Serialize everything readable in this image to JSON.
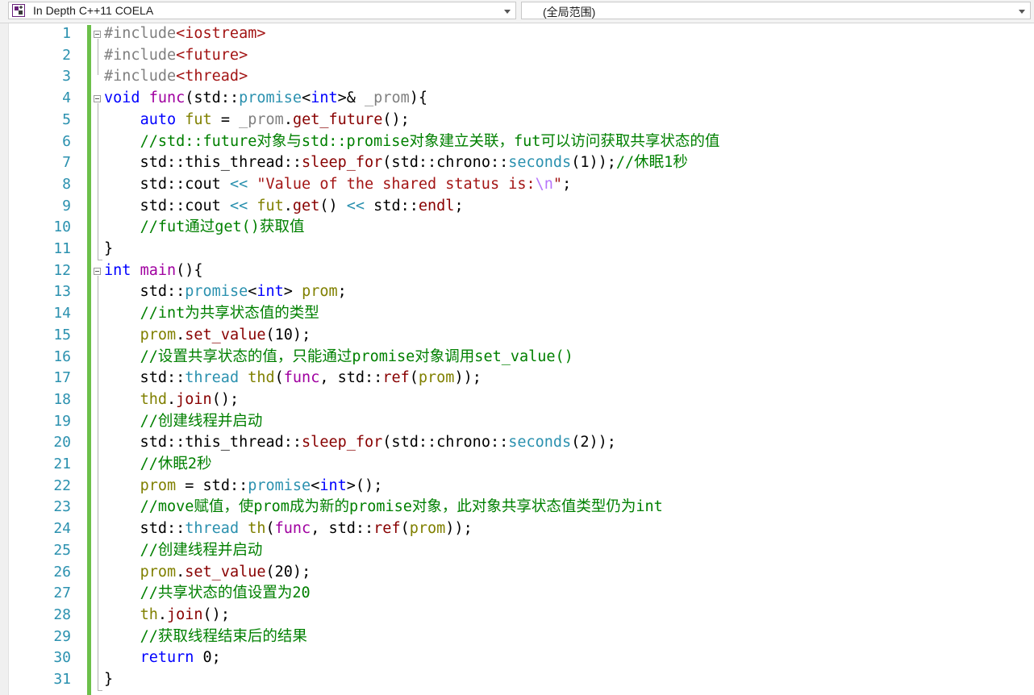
{
  "toolbar": {
    "project_label": "In Depth C++11 COELA",
    "scope_label": "(全局范围)",
    "project_icon": "cpp-project-icon",
    "dropdown_icon": "chevron-down-icon"
  },
  "editor": {
    "colors": {
      "keyword": "#0000ff",
      "type": "#2b91af",
      "comment": "#008000",
      "string": "#a31515",
      "function": "#880000",
      "line_number": "#2b91af",
      "change_bar": "#6cc04a"
    },
    "lines": [
      {
        "n": "1",
        "tokens": [
          [
            "pp",
            "#include"
          ],
          [
            "inc",
            "<iostream>"
          ]
        ]
      },
      {
        "n": "2",
        "tokens": [
          [
            "pp",
            "#include"
          ],
          [
            "inc",
            "<future>"
          ]
        ]
      },
      {
        "n": "3",
        "tokens": [
          [
            "pp",
            "#include"
          ],
          [
            "inc",
            "<thread>"
          ]
        ]
      },
      {
        "n": "4",
        "tokens": [
          [
            "kw",
            "void"
          ],
          [
            "",
            "",
            ""
          ],
          [
            "",
            ""
          ],
          [
            "",
            " "
          ],
          [
            "mfn",
            "func"
          ],
          [
            "",
            "(std::"
          ],
          [
            "ty",
            "promise"
          ],
          [
            "",
            "<"
          ],
          [
            "kw",
            "int"
          ],
          [
            "",
            ">& "
          ],
          [
            "pm",
            "_prom"
          ],
          [
            "",
            "){"
          ]
        ]
      },
      {
        "n": "5",
        "tokens": [
          [
            "",
            "    "
          ],
          [
            "kw",
            "auto"
          ],
          [
            "",
            " "
          ],
          [
            "var",
            "fut"
          ],
          [
            "",
            " = "
          ],
          [
            "pm",
            "_prom"
          ],
          [
            "",
            "."
          ],
          [
            "fn",
            "get_future"
          ],
          [
            "",
            "();"
          ]
        ]
      },
      {
        "n": "6",
        "tokens": [
          [
            "",
            "    "
          ],
          [
            "cm",
            "//std::future对象与std::promise对象建立关联，fut可以访问获取共享状态的值"
          ]
        ]
      },
      {
        "n": "7",
        "tokens": [
          [
            "",
            "    std::this_thread::"
          ],
          [
            "fn",
            "sleep_for"
          ],
          [
            "",
            "(std::chrono::"
          ],
          [
            "ty",
            "seconds"
          ],
          [
            "",
            "(1));"
          ],
          [
            "cm",
            "//休眠1秒"
          ]
        ]
      },
      {
        "n": "8",
        "tokens": [
          [
            "",
            "    std::cout "
          ],
          [
            "ty",
            "<<"
          ],
          [
            "",
            " "
          ],
          [
            "str",
            "\"Value of the shared status is:"
          ],
          [
            "esc",
            "\\n"
          ],
          [
            "str",
            "\""
          ],
          [
            "",
            ";"
          ]
        ]
      },
      {
        "n": "9",
        "tokens": [
          [
            "",
            "    std::cout "
          ],
          [
            "ty",
            "<<"
          ],
          [
            "",
            " "
          ],
          [
            "var",
            "fut"
          ],
          [
            "",
            "."
          ],
          [
            "fn",
            "get"
          ],
          [
            "",
            "() "
          ],
          [
            "ty",
            "<<"
          ],
          [
            "",
            " std::"
          ],
          [
            "fn",
            "endl"
          ],
          [
            "",
            ";"
          ]
        ]
      },
      {
        "n": "10",
        "tokens": [
          [
            "",
            "    "
          ],
          [
            "cm",
            "//fut通过get()获取值"
          ]
        ]
      },
      {
        "n": "11",
        "tokens": [
          [
            "",
            "}"
          ]
        ]
      },
      {
        "n": "12",
        "tokens": [
          [
            "kw",
            "int"
          ],
          [
            "",
            " "
          ],
          [
            "mfn",
            "main"
          ],
          [
            "",
            "(){"
          ]
        ]
      },
      {
        "n": "13",
        "tokens": [
          [
            "",
            "    std::"
          ],
          [
            "ty",
            "promise"
          ],
          [
            "",
            "<"
          ],
          [
            "kw",
            "int"
          ],
          [
            "",
            "> "
          ],
          [
            "var",
            "prom"
          ],
          [
            "",
            ";"
          ]
        ]
      },
      {
        "n": "14",
        "tokens": [
          [
            "",
            "    "
          ],
          [
            "cm",
            "//int为共享状态值的类型"
          ]
        ]
      },
      {
        "n": "15",
        "tokens": [
          [
            "",
            "    "
          ],
          [
            "var",
            "prom"
          ],
          [
            "",
            "."
          ],
          [
            "fn",
            "set_value"
          ],
          [
            "",
            "(10);"
          ]
        ]
      },
      {
        "n": "16",
        "tokens": [
          [
            "",
            "    "
          ],
          [
            "cm",
            "//设置共享状态的值，只能通过promise对象调用set_value()"
          ]
        ]
      },
      {
        "n": "17",
        "tokens": [
          [
            "",
            "    std::"
          ],
          [
            "ty",
            "thread"
          ],
          [
            "",
            " "
          ],
          [
            "var",
            "thd"
          ],
          [
            "",
            "("
          ],
          [
            "mfn",
            "func"
          ],
          [
            "",
            ", std::"
          ],
          [
            "fn",
            "ref"
          ],
          [
            "",
            "("
          ],
          [
            "var",
            "prom"
          ],
          [
            "",
            "));"
          ]
        ]
      },
      {
        "n": "18",
        "tokens": [
          [
            "",
            "    "
          ],
          [
            "var",
            "thd"
          ],
          [
            "",
            "."
          ],
          [
            "fn",
            "join"
          ],
          [
            "",
            "();"
          ]
        ]
      },
      {
        "n": "19",
        "tokens": [
          [
            "",
            "    "
          ],
          [
            "cm",
            "//创建线程并启动"
          ]
        ]
      },
      {
        "n": "20",
        "tokens": [
          [
            "",
            "    std::this_thread::"
          ],
          [
            "fn",
            "sleep_for"
          ],
          [
            "",
            "(std::chrono::"
          ],
          [
            "ty",
            "seconds"
          ],
          [
            "",
            "(2));"
          ]
        ]
      },
      {
        "n": "21",
        "tokens": [
          [
            "",
            "    "
          ],
          [
            "cm",
            "//休眠2秒"
          ]
        ]
      },
      {
        "n": "22",
        "tokens": [
          [
            "",
            "    "
          ],
          [
            "var",
            "prom"
          ],
          [
            "",
            " = std::"
          ],
          [
            "ty",
            "promise"
          ],
          [
            "",
            "<"
          ],
          [
            "kw",
            "int"
          ],
          [
            "",
            ">();"
          ]
        ]
      },
      {
        "n": "23",
        "tokens": [
          [
            "",
            "    "
          ],
          [
            "cm",
            "//move赋值，使prom成为新的promise对象，此对象共享状态值类型仍为int"
          ]
        ]
      },
      {
        "n": "24",
        "tokens": [
          [
            "",
            "    std::"
          ],
          [
            "ty",
            "thread"
          ],
          [
            "",
            " "
          ],
          [
            "var",
            "th"
          ],
          [
            "",
            "("
          ],
          [
            "mfn",
            "func"
          ],
          [
            "",
            ", std::"
          ],
          [
            "fn",
            "ref"
          ],
          [
            "",
            "("
          ],
          [
            "var",
            "prom"
          ],
          [
            "",
            "));"
          ]
        ]
      },
      {
        "n": "25",
        "tokens": [
          [
            "",
            "    "
          ],
          [
            "cm",
            "//创建线程并启动"
          ]
        ]
      },
      {
        "n": "26",
        "tokens": [
          [
            "",
            "    "
          ],
          [
            "var",
            "prom"
          ],
          [
            "",
            "."
          ],
          [
            "fn",
            "set_value"
          ],
          [
            "",
            "(20);"
          ]
        ]
      },
      {
        "n": "27",
        "tokens": [
          [
            "",
            "    "
          ],
          [
            "cm",
            "//共享状态的值设置为20"
          ]
        ]
      },
      {
        "n": "28",
        "tokens": [
          [
            "",
            "    "
          ],
          [
            "var",
            "th"
          ],
          [
            "",
            "."
          ],
          [
            "fn",
            "join"
          ],
          [
            "",
            "();"
          ]
        ]
      },
      {
        "n": "29",
        "tokens": [
          [
            "",
            "    "
          ],
          [
            "cm",
            "//获取线程结束后的结果"
          ]
        ]
      },
      {
        "n": "30",
        "tokens": [
          [
            "",
            "    "
          ],
          [
            "kw",
            "return"
          ],
          [
            "",
            " 0;"
          ]
        ]
      },
      {
        "n": "31",
        "tokens": [
          [
            "",
            "}"
          ]
        ]
      }
    ]
  }
}
